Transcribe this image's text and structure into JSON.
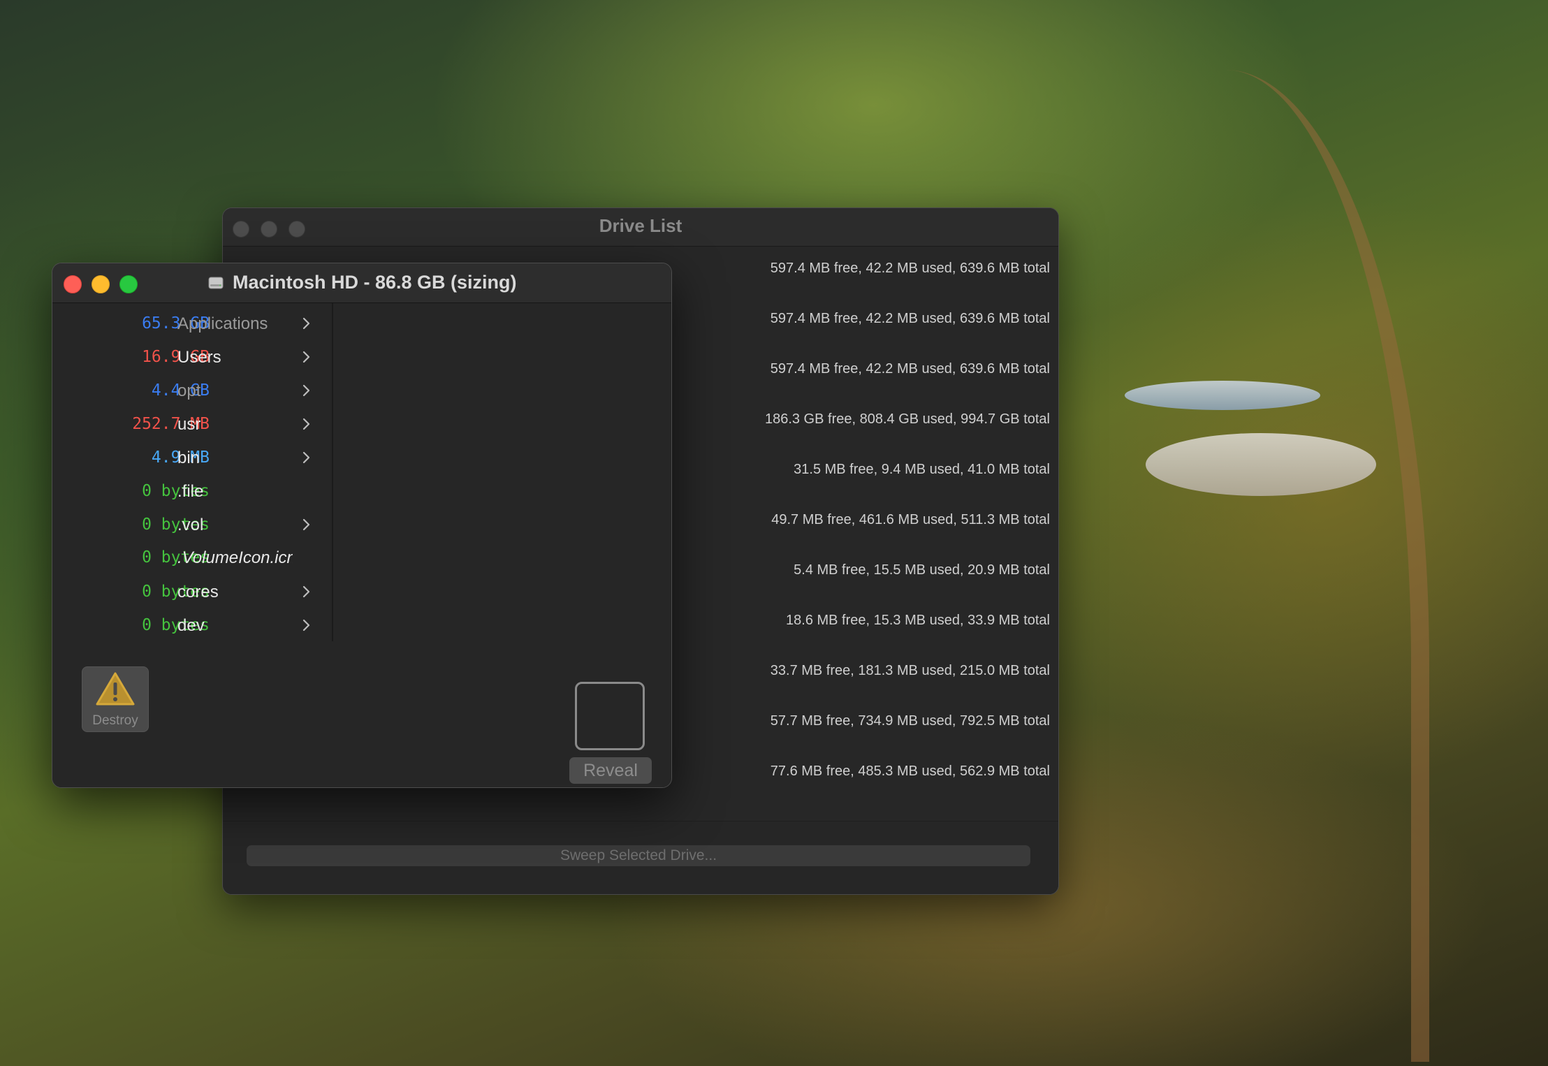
{
  "drive_list": {
    "title": "Drive List",
    "rows": [
      "597.4 MB free, 42.2 MB used, 639.6 MB total",
      "597.4 MB free, 42.2 MB used, 639.6 MB total",
      "597.4 MB free, 42.2 MB used, 639.6 MB total",
      "186.3 GB free, 808.4 GB used, 994.7 GB total",
      "31.5 MB free, 9.4 MB used, 41.0 MB total",
      "49.7 MB free, 461.6 MB used, 511.3 MB total",
      "5.4 MB free, 15.5 MB used, 20.9 MB total",
      "18.6 MB free, 15.3 MB used, 33.9 MB total",
      "33.7 MB free, 181.3 MB used, 215.0 MB total",
      "57.7 MB free, 734.9 MB used, 792.5 MB total",
      "77.6 MB free, 485.3 MB used, 562.9 MB total"
    ],
    "sweep_label": "Sweep Selected Drive..."
  },
  "mac_window": {
    "title": "Macintosh HD - 86.8 GB (sizing)",
    "icon": "hard-disk-icon",
    "items": [
      {
        "size": "65.3 GB",
        "name": "Applications",
        "color": "#3a7cf0",
        "dim": true,
        "chevron": true
      },
      {
        "size": "16.9 GB",
        "name": "Users",
        "color": "#f0524a",
        "dim": false,
        "chevron": true
      },
      {
        "size": "4.4 GB",
        "name": "opt",
        "color": "#3a7cf0",
        "dim": true,
        "chevron": true
      },
      {
        "size": "252.7 MB",
        "name": "usr",
        "color": "#f0524a",
        "dim": false,
        "chevron": true
      },
      {
        "size": "4.9 MB",
        "name": "bin",
        "color": "#48a7f5",
        "dim": false,
        "chevron": true
      },
      {
        "size": "0 bytes",
        "name": ".file",
        "color": "#45c23e",
        "dim": false,
        "chevron": false
      },
      {
        "size": "0 bytes",
        "name": ".vol",
        "color": "#45c23e",
        "dim": false,
        "chevron": true
      },
      {
        "size": "0 bytes",
        "name": ".VolumeIcon.icns",
        "color": "#45c23e",
        "dim": false,
        "chevron": false
      },
      {
        "size": "0 bytes",
        "name": "cores",
        "color": "#45c23e",
        "dim": false,
        "chevron": true
      },
      {
        "size": "0 bytes",
        "name": "dev",
        "color": "#45c23e",
        "dim": false,
        "chevron": true
      }
    ],
    "destroy_label": "Destroy",
    "reveal_label": "Reveal"
  }
}
